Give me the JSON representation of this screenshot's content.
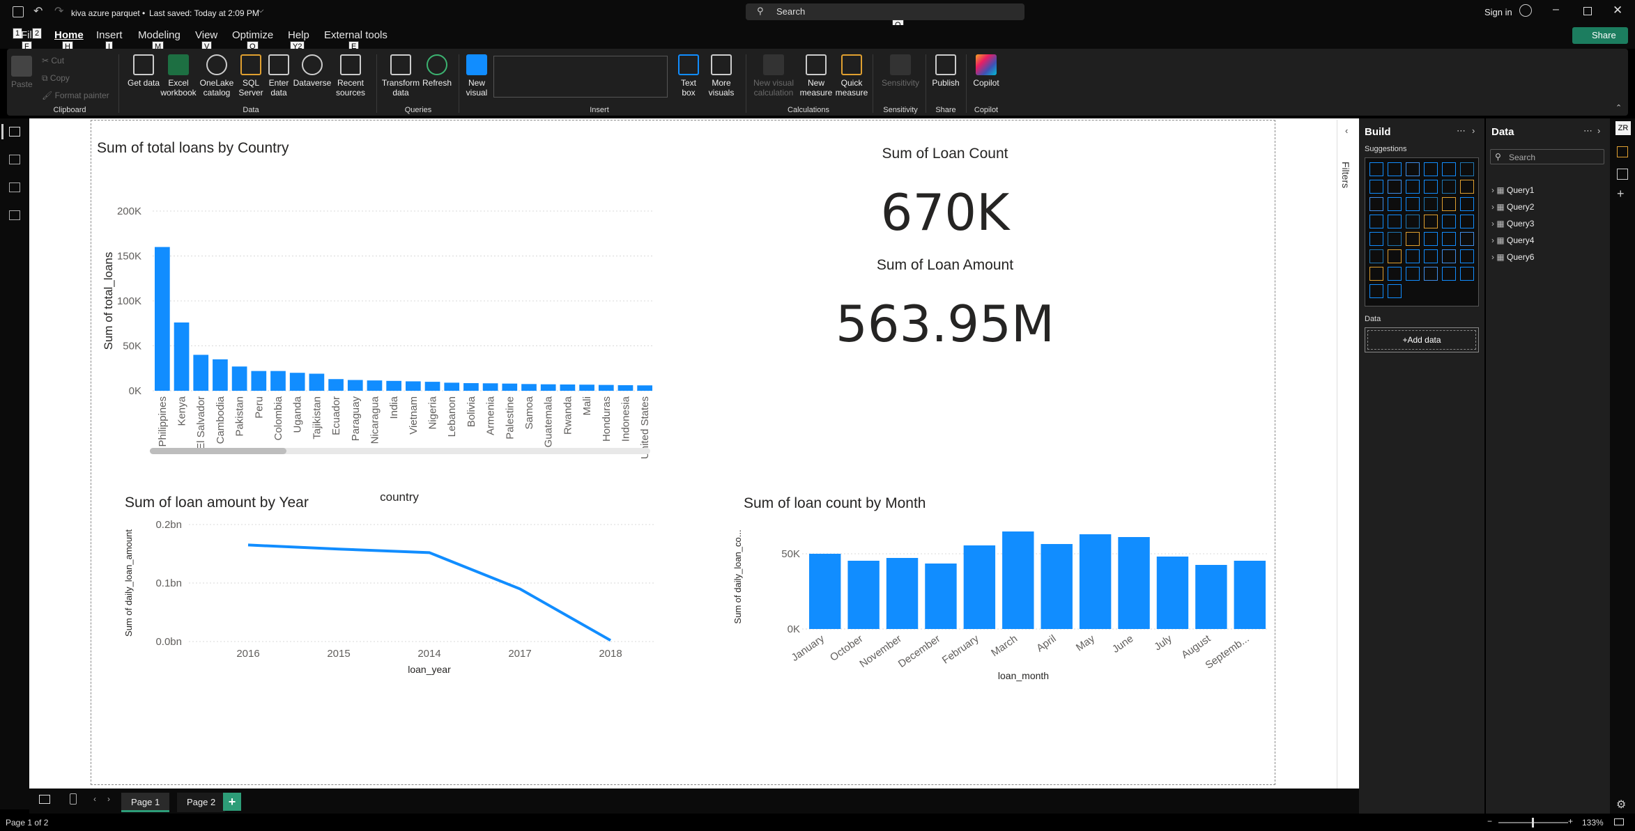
{
  "titlebar": {
    "file_title": "kiva azure parquet",
    "saved_status": "Last saved: Today at 2:09 PM",
    "search_placeholder": "Search",
    "search_keytip": "Q",
    "signin": "Sign in"
  },
  "menu": {
    "items": [
      "File",
      "Home",
      "Insert",
      "Modeling",
      "View",
      "Optimize",
      "Help",
      "External tools"
    ],
    "keytips": [
      "F",
      "H",
      "I",
      "M",
      "V",
      "O",
      "Y2",
      "E"
    ],
    "number_keytips": [
      "1",
      "2"
    ],
    "share": "Share",
    "share_keytip": "S"
  },
  "ribbon": {
    "clipboard": {
      "paste": "Paste",
      "cut": "Cut",
      "copy": "Copy",
      "format_painter": "Format painter",
      "group": "Clipboard"
    },
    "data": {
      "get_data": "Get data",
      "excel": "Excel workbook",
      "onelake": "OneLake catalog",
      "sql": "SQL Server",
      "enter": "Enter data",
      "dataverse": "Dataverse",
      "recent": "Recent sources",
      "group": "Data"
    },
    "queries": {
      "transform": "Transform data",
      "refresh": "Refresh",
      "group": "Queries"
    },
    "insert": {
      "new_visual": "New visual",
      "text_box": "Text box",
      "more_visuals": "More visuals",
      "group": "Insert"
    },
    "calculations": {
      "new_visual_calc": "New visual calculation",
      "new_measure": "New measure",
      "quick_measure": "Quick measure",
      "group": "Calculations"
    },
    "sensitivity": {
      "label": "Sensitivity",
      "group": "Sensitivity"
    },
    "share": {
      "publish": "Publish",
      "group": "Share"
    },
    "copilot": {
      "label": "Copilot",
      "group": "Copilot"
    }
  },
  "visuals": {
    "country_chart": {
      "title": "Sum of total loans by Country",
      "xlabel": "country",
      "ylabel": "Sum of total_loans",
      "yticks": [
        "200K",
        "150K",
        "100K",
        "50K",
        "0K"
      ]
    },
    "card1": {
      "label": "Sum of Loan Count",
      "value": "670K"
    },
    "card2": {
      "label": "Sum of Loan Amount",
      "value": "563.95M"
    },
    "year_chart": {
      "title": "Sum of loan amount by Year",
      "xlabel": "loan_year",
      "ylabel": "Sum of daily_loan_amount",
      "yticks": [
        "0.2bn",
        "0.1bn",
        "0.0bn"
      ]
    },
    "month_chart": {
      "title": "Sum of loan count by Month",
      "xlabel": "loan_month",
      "ylabel": "Sum of daily_loan_co...",
      "yticks": [
        "50K",
        "0K"
      ]
    }
  },
  "chart_data": [
    {
      "type": "bar",
      "title": "Sum of total loans by Country",
      "xlabel": "country",
      "ylabel": "Sum of total_loans",
      "ylim": [
        0,
        200000
      ],
      "categories": [
        "Philippines",
        "Kenya",
        "El Salvador",
        "Cambodia",
        "Pakistan",
        "Peru",
        "Colombia",
        "Uganda",
        "Tajikistan",
        "Ecuador",
        "Paraguay",
        "Nicaragua",
        "India",
        "Vietnam",
        "Nigeria",
        "Lebanon",
        "Bolivia",
        "Armenia",
        "Palestine",
        "Samoa",
        "Guatemala",
        "Rwanda",
        "Mali",
        "Honduras",
        "Indonesia",
        "United States"
      ],
      "values": [
        160000,
        76000,
        40000,
        35000,
        27000,
        22000,
        22000,
        20000,
        19000,
        13000,
        12000,
        11500,
        11000,
        10500,
        10000,
        9000,
        8500,
        8300,
        8000,
        7500,
        7200,
        7000,
        6800,
        6500,
        6200,
        6000
      ],
      "color": "#118DFF"
    },
    {
      "type": "line",
      "title": "Sum of loan amount by Year",
      "xlabel": "loan_year",
      "ylabel": "Sum of daily_loan_amount",
      "ylim": [
        0,
        0.2
      ],
      "categories": [
        "2016",
        "2015",
        "2014",
        "2017",
        "2018"
      ],
      "values": [
        0.165,
        0.158,
        0.152,
        0.09,
        0.002
      ],
      "color": "#118DFF"
    },
    {
      "type": "bar",
      "title": "Sum of loan count by Month",
      "xlabel": "loan_month",
      "ylabel": "Sum of daily_loan_co...",
      "ylim": [
        0,
        75000
      ],
      "categories": [
        "January",
        "October",
        "November",
        "December",
        "February",
        "March",
        "April",
        "May",
        "June",
        "July",
        "August",
        "Septemb..."
      ],
      "values": [
        54000,
        49000,
        51000,
        47000,
        60000,
        70000,
        61000,
        68000,
        66000,
        52000,
        46000,
        49000
      ],
      "color": "#118DFF"
    }
  ],
  "filters": {
    "label": "Filters"
  },
  "build": {
    "title": "Build",
    "suggestions": "Suggestions",
    "data_label": "Data",
    "add_data": "+Add data"
  },
  "datapane": {
    "title": "Data",
    "search_placeholder": "Search",
    "queries": [
      "Query1",
      "Query2",
      "Query3",
      "Query4",
      "Query6"
    ]
  },
  "pages": {
    "tabs": [
      "Page 1",
      "Page 2"
    ],
    "add": "+"
  },
  "status": {
    "page_info": "Page 1 of 2",
    "zoom": "133%"
  },
  "colors": {
    "accent": "#118DFF",
    "share_green": "#1c7d5f",
    "tab_accent": "#2d9d78"
  }
}
